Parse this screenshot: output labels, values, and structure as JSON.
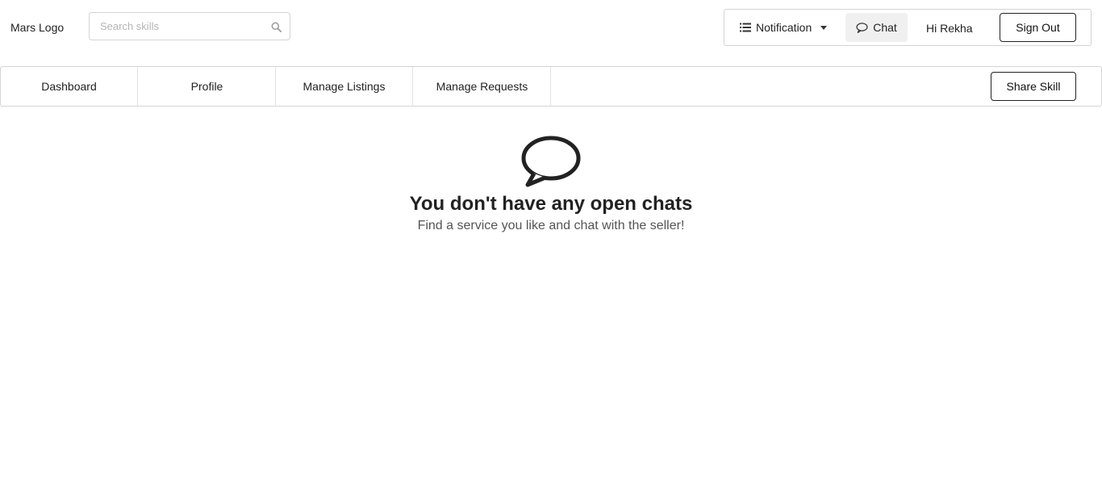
{
  "header": {
    "logo_text": "Mars Logo",
    "search": {
      "placeholder": "Search skills",
      "value": ""
    },
    "menu": {
      "notification_label": "Notification",
      "chat_label": "Chat",
      "greeting": "Hi Rekha",
      "sign_out_label": "Sign Out"
    }
  },
  "nav": {
    "tabs": [
      {
        "label": "Dashboard"
      },
      {
        "label": "Profile"
      },
      {
        "label": "Manage Listings"
      },
      {
        "label": "Manage Requests"
      }
    ],
    "share_skill_label": "Share Skill"
  },
  "main": {
    "empty_title": "You don't have any open chats",
    "empty_subtitle": "Find a service you like and chat with the seller!"
  },
  "icons": {
    "search": "search-icon",
    "notification": "list-icon",
    "dropdown": "caret-down-icon",
    "chat": "chat-bubble-icon"
  }
}
